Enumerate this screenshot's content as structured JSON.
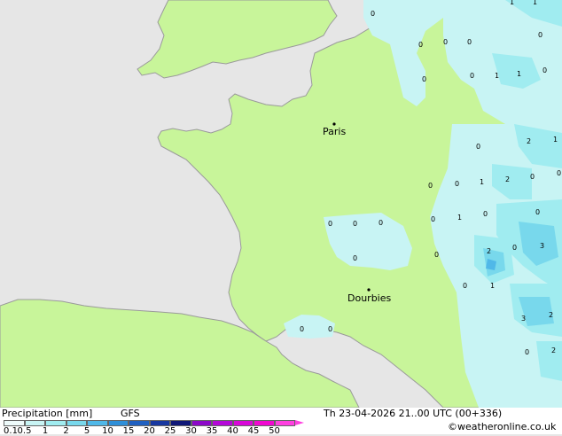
{
  "map": {
    "cities": [
      {
        "name": "Paris"
      },
      {
        "name": "Dourbies"
      }
    ],
    "grid_values": [
      "0",
      "0",
      "0",
      "0",
      "1",
      "1",
      "1",
      "0",
      "0",
      "0",
      "1",
      "2",
      "0",
      "0",
      "0",
      "0",
      "1",
      "2",
      "1",
      "0",
      "0",
      "0",
      "0",
      "1",
      "3",
      "2",
      "1",
      "0",
      "0",
      "0",
      "0",
      "0",
      "0",
      "0",
      "0",
      "2",
      "3",
      "2",
      "0",
      "0",
      "0"
    ]
  },
  "footer": {
    "title": "Precipitation [mm]",
    "model": "GFS",
    "datetime": "Th 23-04-2026 21..00 UTC (00+336)",
    "credit": "©weatheronline.co.uk",
    "scale": {
      "labels": [
        "0.1",
        "0.5",
        "1",
        "2",
        "5",
        "10",
        "15",
        "20",
        "25",
        "30",
        "35",
        "40",
        "45",
        "50"
      ],
      "colors": [
        "#eefbfb",
        "#c8f4f4",
        "#a0ecf0",
        "#78d8ec",
        "#50b8e8",
        "#2f8fd8",
        "#2060c0",
        "#1838a0",
        "#101878",
        "#8c08c8",
        "#b408d8",
        "#d808d8",
        "#f008d0",
        "#ff40e0"
      ]
    }
  }
}
